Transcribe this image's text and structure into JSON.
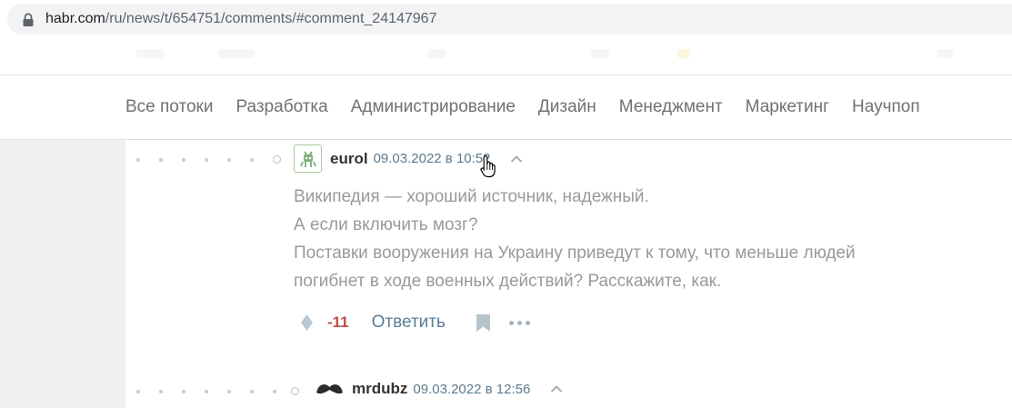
{
  "browser": {
    "url_host": "habr.com",
    "url_path": "/ru/news/t/654751/comments/#comment_24147967"
  },
  "nav": {
    "items": [
      {
        "label": "Все потоки"
      },
      {
        "label": "Разработка"
      },
      {
        "label": "Администрирование"
      },
      {
        "label": "Дизайн"
      },
      {
        "label": "Менеджмент"
      },
      {
        "label": "Маркетинг"
      },
      {
        "label": "Научпоп"
      }
    ]
  },
  "comments": [
    {
      "author": "eurol",
      "date": "09.03.2022 в 10:52",
      "avatar_icon": "robot-avatar-icon",
      "body": [
        "Википедия — хороший источник, надежный.",
        "А если включить мозг?",
        "Поставки вооружения на Украину приведут к тому, что меньше людей",
        "погибнет в ходе военных действий? Расскажите, как."
      ],
      "score": "-11",
      "reply_label": "Ответить"
    },
    {
      "author": "mrdubz",
      "date": "09.03.2022 в 12:56",
      "avatar_icon": "mustache-avatar-icon"
    }
  ],
  "colors": {
    "score_negative": "#c34b4b",
    "link": "#5b7d96",
    "nav_text": "#6e7275"
  }
}
